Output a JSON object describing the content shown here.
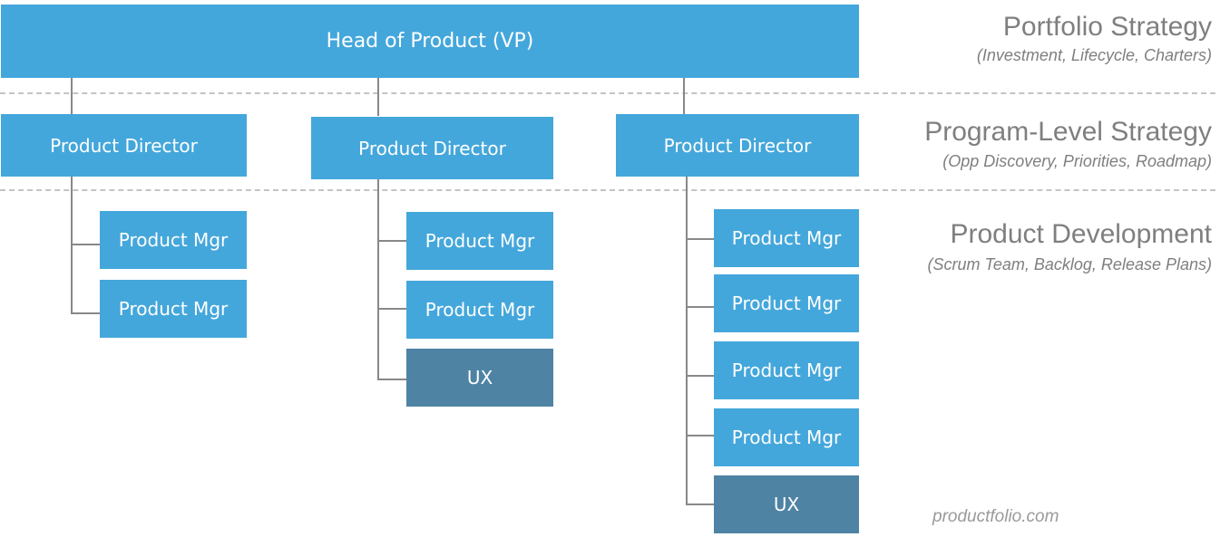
{
  "head": {
    "label": "Head of Product (VP)"
  },
  "directors": [
    {
      "label": "Product Director",
      "reports": [
        {
          "label": "Product Mgr",
          "type": "pm"
        },
        {
          "label": "Product Mgr",
          "type": "pm"
        }
      ]
    },
    {
      "label": "Product Director",
      "reports": [
        {
          "label": "Product Mgr",
          "type": "pm"
        },
        {
          "label": "Product Mgr",
          "type": "pm"
        },
        {
          "label": "UX",
          "type": "ux"
        }
      ]
    },
    {
      "label": "Product Director",
      "reports": [
        {
          "label": "Product Mgr",
          "type": "pm"
        },
        {
          "label": "Product Mgr",
          "type": "pm"
        },
        {
          "label": "Product Mgr",
          "type": "pm"
        },
        {
          "label": "Product Mgr",
          "type": "pm"
        },
        {
          "label": "UX",
          "type": "ux"
        }
      ]
    }
  ],
  "levels": [
    {
      "title": "Portfolio Strategy",
      "subtitle": "(Investment, Lifecycle, Charters)"
    },
    {
      "title": "Program-Level Strategy",
      "subtitle": "(Opp Discovery, Priorities, Roadmap)"
    },
    {
      "title": "Product Development",
      "subtitle": "(Scrum Team, Backlog, Release Plans)"
    }
  ],
  "credit": "productfolio.com",
  "colors": {
    "box": "#44a7db",
    "ux_box": "#4e83a4",
    "connector": "#888888",
    "level_text": "#7f7f7f"
  }
}
